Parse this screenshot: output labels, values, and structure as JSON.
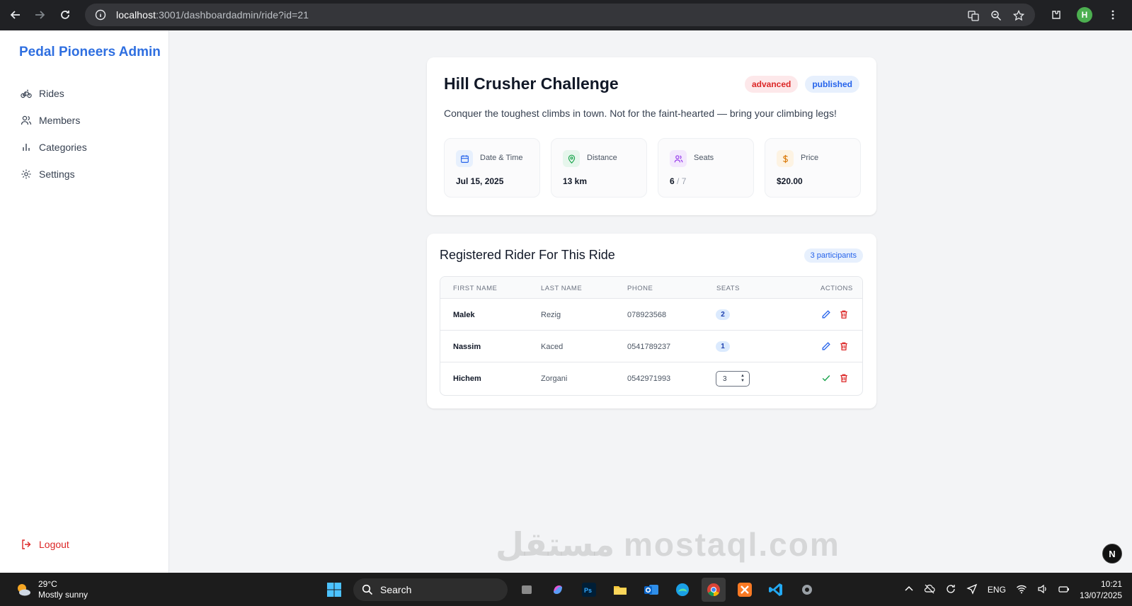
{
  "browser": {
    "url_host": "localhost",
    "url_path": ":3001/dashboardadmin/ride?id=21",
    "profile_initial": "H"
  },
  "sidebar": {
    "brand": "Pedal Pioneers Admin",
    "items": [
      {
        "label": "Rides",
        "icon": "bike-icon"
      },
      {
        "label": "Members",
        "icon": "users-icon"
      },
      {
        "label": "Categories",
        "icon": "bar-chart-icon"
      },
      {
        "label": "Settings",
        "icon": "gear-icon"
      }
    ],
    "logout": "Logout"
  },
  "ride": {
    "title": "Hill Crusher Challenge",
    "level_badge": "advanced",
    "status_badge": "published",
    "description": "Conquer the toughest climbs in town. Not for the faint-hearted — bring your climbing legs!",
    "stats": [
      {
        "label": "Date & Time",
        "value": "Jul 15, 2025",
        "icon": "calendar-icon",
        "color": "#2563eb"
      },
      {
        "label": "Distance",
        "value": "13 km",
        "icon": "map-pin-icon",
        "color": "#16a34a"
      },
      {
        "label": "Seats",
        "value": "6",
        "value_suffix": " / 7",
        "icon": "users-icon",
        "color": "#9333ea"
      },
      {
        "label": "Price",
        "value": "$20.00",
        "icon": "dollar-icon",
        "color": "#d97706"
      }
    ]
  },
  "riders": {
    "title": "Registered Rider For This Ride",
    "count_badge": "3 participants",
    "columns": [
      "FIRST NAME",
      "LAST NAME",
      "PHONE",
      "SEATS",
      "ACTIONS"
    ],
    "rows": [
      {
        "first": "Malek",
        "last": "Rezig",
        "phone": "078923568",
        "seats": "2"
      },
      {
        "first": "Nassim",
        "last": "Kaced",
        "phone": "0541789237",
        "seats": "1"
      },
      {
        "first": "Hichem",
        "last": "Zorgani",
        "phone": "0542971993",
        "seats": "3"
      }
    ]
  },
  "taskbar": {
    "temp": "29°C",
    "weather": "Mostly sunny",
    "search": "Search",
    "lang": "ENG",
    "time": "10:21",
    "date": "13/07/2025"
  },
  "dev_badge": "N",
  "watermark": "مستقل mostaql.com"
}
